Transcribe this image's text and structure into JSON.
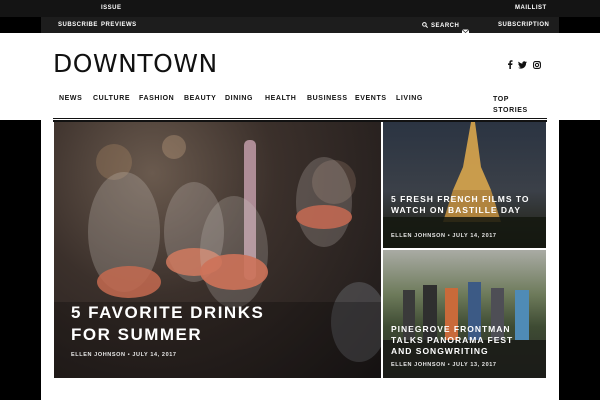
{
  "topbar": {
    "issue_label": "ISSUE",
    "maillist_label": "MAILLIST"
  },
  "secondary": {
    "subscribe_label": "SUBSCRIBE",
    "previews_label": "PREVIEWS",
    "search_label": "SEARCH",
    "subscription_label": "SUBSCRIPTION"
  },
  "brand": {
    "logo_text": "DOWNTOWN"
  },
  "social": {
    "icons": [
      "facebook-icon",
      "twitter-icon",
      "instagram-icon"
    ]
  },
  "nav": {
    "items": [
      "NEWS",
      "CULTURE",
      "FASHION",
      "BEAUTY",
      "DINING",
      "HEALTH",
      "BUSINESS",
      "EVENTS",
      "LIVING"
    ],
    "top_stories": "TOP STORIES"
  },
  "featured": [
    {
      "title": "5 FAVORITE DRINKS FOR SUMMER",
      "author": "ELLEN JOHNSON",
      "date": "JULY 14, 2017"
    },
    {
      "title": "5 FRESH FRENCH FILMS TO WATCH ON BASTILLE DAY",
      "author": "ELLEN JOHNSON",
      "date": "JULY 14, 2017"
    },
    {
      "title": "PINEGROVE FRONTMAN TALKS PANORAMA FEST AND SONGWRITING",
      "author": "ELLEN JOHNSON",
      "date": "JULY 13, 2017"
    }
  ],
  "colors": {
    "topbar": "#141414",
    "secbar": "#1d1d1d",
    "text_dark": "#111111",
    "white": "#ffffff"
  }
}
